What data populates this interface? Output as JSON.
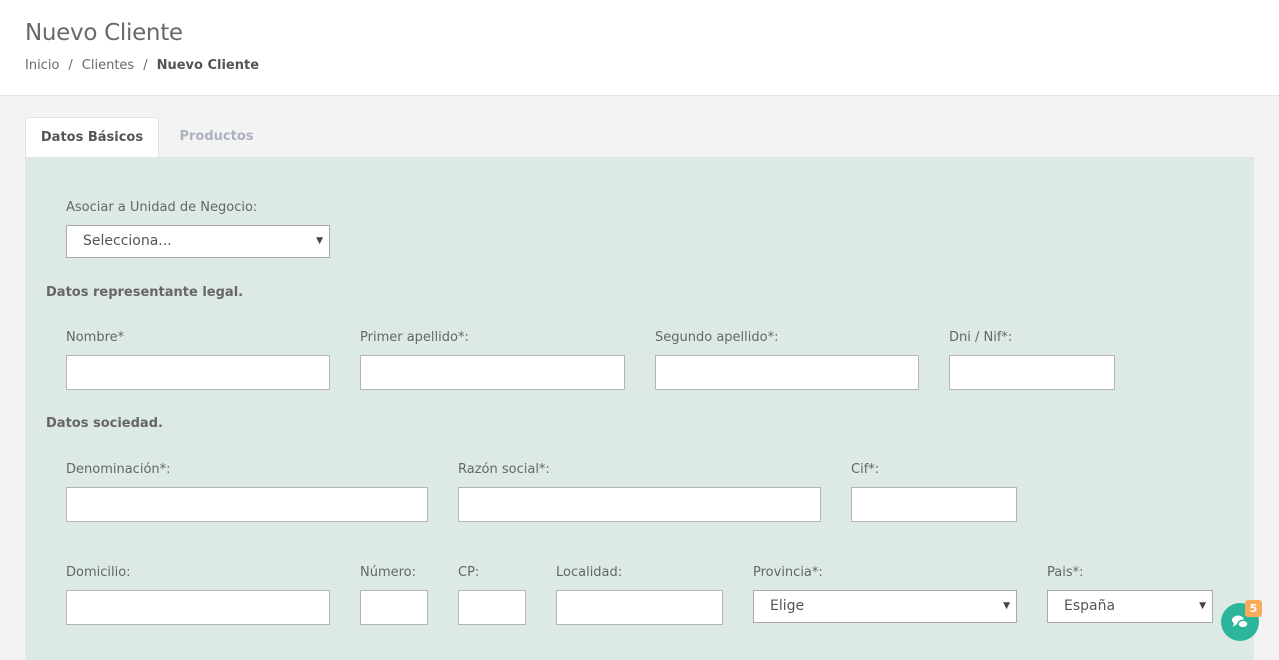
{
  "header": {
    "title": "Nuevo Cliente",
    "breadcrumb": [
      "Inicio",
      "Clientes",
      "Nuevo Cliente"
    ]
  },
  "tabs": [
    {
      "label": "Datos Básicos",
      "active": true
    },
    {
      "label": "Productos",
      "active": false
    }
  ],
  "form": {
    "unidad_negocio": {
      "label": "Asociar a Unidad de Negocio:",
      "value": "Selecciona..."
    },
    "section_representante": "Datos representante legal.",
    "representante": {
      "nombre": {
        "label": "Nombre*",
        "value": ""
      },
      "primer_apellido": {
        "label": "Primer apellido*:",
        "value": ""
      },
      "segundo_apellido": {
        "label": "Segundo apellido*:",
        "value": ""
      },
      "dni": {
        "label": "Dni / Nif*:",
        "value": ""
      }
    },
    "section_sociedad": "Datos sociedad.",
    "sociedad": {
      "denominacion": {
        "label": "Denominación*:",
        "value": ""
      },
      "razon_social": {
        "label": "Razón social*:",
        "value": ""
      },
      "cif": {
        "label": "Cif*:",
        "value": ""
      }
    },
    "direccion": {
      "domicilio": {
        "label": "Domicilio:",
        "value": ""
      },
      "numero": {
        "label": "Número:",
        "value": ""
      },
      "cp": {
        "label": "CP:",
        "value": ""
      },
      "localidad": {
        "label": "Localidad:",
        "value": ""
      },
      "provincia": {
        "label": "Provincia*:",
        "value": "Elige"
      },
      "pais": {
        "label": "Pais*:",
        "value": "España"
      }
    }
  },
  "chat": {
    "icon": "chat-icon",
    "badge": "5"
  },
  "colors": {
    "panel_bg": "#dce9e5",
    "chat": "#2bb59a",
    "badge": "#f8ac59"
  }
}
